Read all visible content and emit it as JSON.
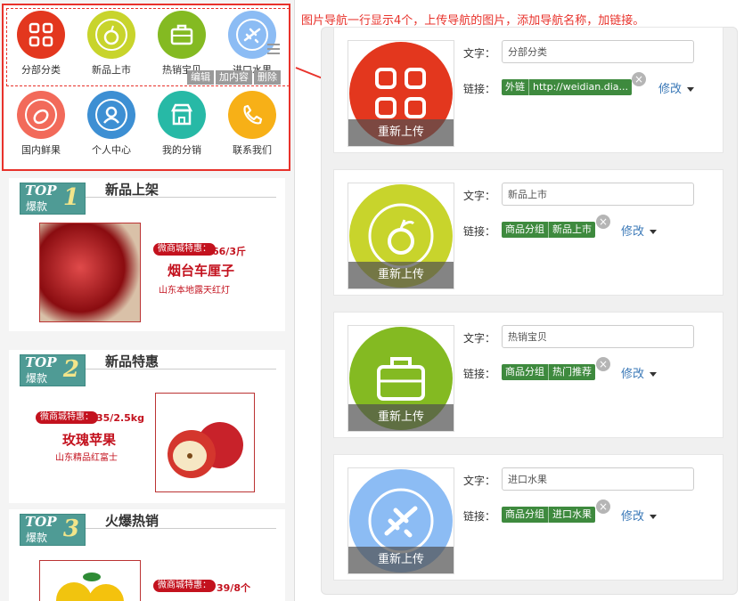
{
  "annotation": "图片导航一行显示4个，上传导航的图片，添加导航名称，加链接。",
  "preview": {
    "nav_items": [
      {
        "label": "分部分类",
        "color": "#e3371e",
        "icon": "grid-icon"
      },
      {
        "label": "新品上市",
        "color": "#c8d42c",
        "icon": "apple-icon"
      },
      {
        "label": "热销宝贝",
        "color": "#84ba22",
        "icon": "briefcase-icon"
      },
      {
        "label": "进口水果",
        "color": "#8cbcf4",
        "icon": "airplane-icon"
      },
      {
        "label": "国内鲜果",
        "color": "#f26a5a",
        "icon": "melon-icon"
      },
      {
        "label": "个人中心",
        "color": "#3d8fd3",
        "icon": "user-icon"
      },
      {
        "label": "我的分销",
        "color": "#27b9a6",
        "icon": "shop-icon"
      },
      {
        "label": "联系我们",
        "color": "#f7b017",
        "icon": "phone-icon"
      }
    ],
    "edit_buttons": [
      "编辑",
      "加内容",
      "删除"
    ],
    "cards": [
      {
        "top_label": "TOP",
        "top_num": "1",
        "top_sub": "爆款",
        "title": "新品上架",
        "promo": "微商城特惠：",
        "price": "66/3斤",
        "name": "烟台车厘子",
        "sub": "山东本地露天红灯"
      },
      {
        "top_label": "TOP",
        "top_num": "2",
        "top_sub": "爆款",
        "title": "新品特惠",
        "promo": "微商城特惠：",
        "price": "35/2.5kg",
        "name": "玫瑰苹果",
        "sub": "山东精品红富士"
      },
      {
        "top_label": "TOP",
        "top_num": "3",
        "top_sub": "爆款",
        "title": "火爆热销",
        "promo": "微商城特惠：",
        "price": "39/8个",
        "name": "",
        "sub": ""
      }
    ]
  },
  "editor": {
    "text_label": "文字：",
    "link_label": "链接：",
    "reupload_label": "重新上传",
    "modify_label": "修改",
    "close_glyph": "×",
    "panels": [
      {
        "text": "分部分类",
        "link_type": "外链",
        "link_value": "http://weidian.dia...",
        "color": "#e3371e",
        "icon": "grid-icon"
      },
      {
        "text": "新品上市",
        "link_type": "商品分组",
        "link_value": "新品上市",
        "color": "#c8d42c",
        "icon": "apple-icon"
      },
      {
        "text": "热销宝贝",
        "link_type": "商品分组",
        "link_value": "热门推荐",
        "color": "#84ba22",
        "icon": "briefcase-icon"
      },
      {
        "text": "进口水果",
        "link_type": "商品分组",
        "link_value": "进口水果",
        "color": "#8cbcf4",
        "icon": "airplane-icon"
      }
    ]
  }
}
